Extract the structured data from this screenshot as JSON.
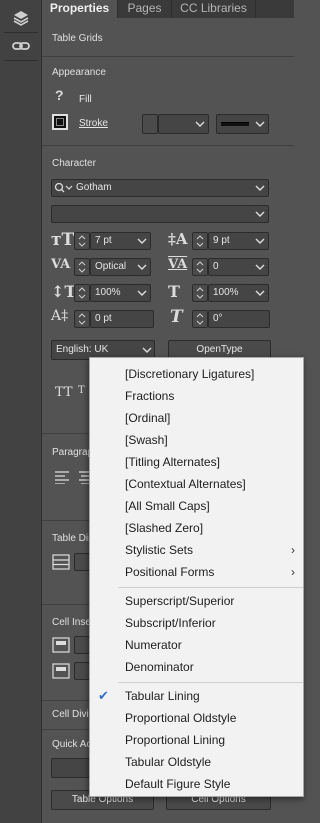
{
  "tabs": [
    {
      "label": "Properties",
      "active": true
    },
    {
      "label": "Pages",
      "active": false
    },
    {
      "label": "CC Libraries",
      "active": false
    }
  ],
  "selection_type": "Table Grids",
  "appearance": {
    "title": "Appearance",
    "fill_label": "Fill",
    "stroke_label": "Stroke"
  },
  "character": {
    "title": "Character",
    "font_family": "Gotham",
    "font_style": "",
    "font_size": "7 pt",
    "leading": "9 pt",
    "kerning": "Optical",
    "tracking": "0",
    "vertical_scale": "100%",
    "horizontal_scale": "100%",
    "baseline_shift": "0 pt",
    "skew": "0°",
    "language": "English: UK",
    "opentype_button": "OpenType"
  },
  "partial_labels": {
    "paragraph": "Paragrap",
    "table_dims": "Table Dir",
    "cell_inset": "Cell Inse",
    "cell_division": "Cell Divis",
    "quick_actions": "Quick Ac"
  },
  "buttons": {
    "table_options": "Table Options",
    "cell_options": "Cell Options"
  },
  "opentype_menu": {
    "group1": [
      {
        "label": "[Discretionary Ligatures]"
      },
      {
        "label": "Fractions"
      },
      {
        "label": "[Ordinal]"
      },
      {
        "label": "[Swash]"
      },
      {
        "label": "[Titling Alternates]"
      },
      {
        "label": "[Contextual Alternates]"
      },
      {
        "label": "[All Small Caps]"
      },
      {
        "label": "[Slashed Zero]"
      },
      {
        "label": "Stylistic Sets",
        "submenu": true
      },
      {
        "label": "Positional Forms",
        "submenu": true
      }
    ],
    "group2": [
      {
        "label": "Superscript/Superior"
      },
      {
        "label": "Subscript/Inferior"
      },
      {
        "label": "Numerator"
      },
      {
        "label": "Denominator"
      }
    ],
    "group3": [
      {
        "label": "Tabular Lining",
        "checked": true
      },
      {
        "label": "Proportional Oldstyle"
      },
      {
        "label": "Proportional Lining"
      },
      {
        "label": "Tabular Oldstyle"
      },
      {
        "label": "Default Figure Style"
      }
    ]
  },
  "icons": {
    "strip": [
      "layers-icon",
      "links-icon"
    ]
  },
  "colors": {
    "panel_bg": "#535353",
    "strip_bg": "#424242",
    "menu_bg": "#f2f2f2",
    "check": "#2f6fcb"
  }
}
